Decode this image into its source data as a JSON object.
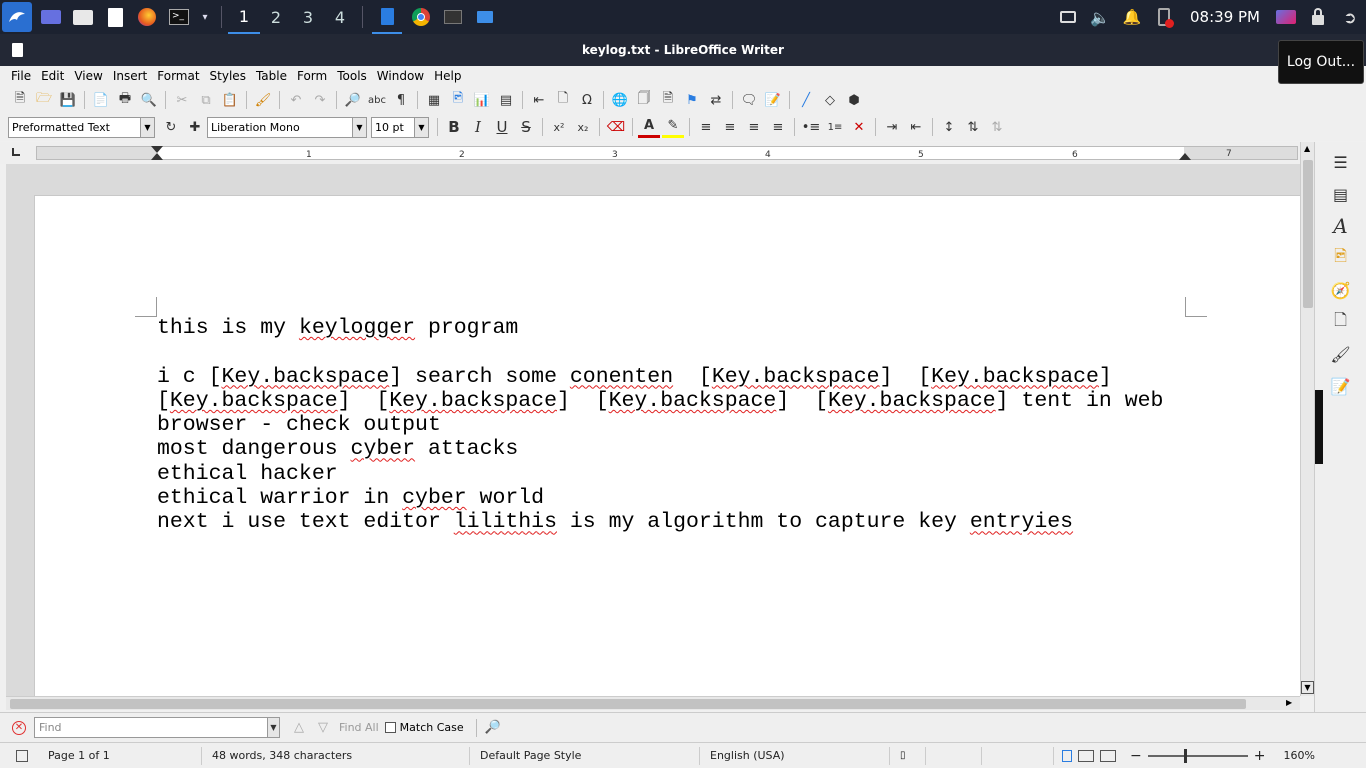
{
  "taskbar": {
    "workspaces": [
      "1",
      "2",
      "3",
      "4"
    ],
    "active_workspace": "1",
    "clock": "08:39 PM",
    "icons": [
      "kali-menu-icon",
      "desktop-icon",
      "files-icon",
      "text-editor-icon",
      "firefox-icon",
      "terminal-icon",
      "writer-icon",
      "chrome-icon",
      "terminal-window-icon",
      "folder-icon",
      "screen-icon",
      "volume-icon",
      "bell-icon",
      "power-manager-icon",
      "display-icon",
      "lock-icon",
      "logout-icon"
    ]
  },
  "window": {
    "title": "keylog.txt - LibreOffice Writer",
    "logout_tooltip": "Log Out..."
  },
  "menubar": {
    "items": [
      "File",
      "Edit",
      "View",
      "Insert",
      "Format",
      "Styles",
      "Table",
      "Form",
      "Tools",
      "Window",
      "Help"
    ]
  },
  "formatting": {
    "paragraph_style": "Preformatted Text",
    "font_name": "Liberation Mono",
    "font_size": "10 pt",
    "bold": "B",
    "italic": "I",
    "underline": "U",
    "strike": "S",
    "font_color": "#cc0000",
    "highlight_color": "#ffff00"
  },
  "ruler": {
    "numbers": [
      "1",
      "2",
      "3",
      "4",
      "5",
      "6",
      "7"
    ]
  },
  "document": {
    "lines": [
      [
        {
          "t": "this is my "
        },
        {
          "t": "keylogger",
          "sq": true
        },
        {
          "t": " program"
        }
      ],
      [
        {
          "t": ""
        }
      ],
      [
        {
          "t": "i c ["
        },
        {
          "t": "Key.backspace",
          "sq": true
        },
        {
          "t": "] search some "
        },
        {
          "t": "conenten",
          "sq": true
        },
        {
          "t": "  ["
        },
        {
          "t": "Key.backspace",
          "sq": true
        },
        {
          "t": "]  ["
        },
        {
          "t": "Key.backspace",
          "sq": true
        },
        {
          "t": "]"
        }
      ],
      [
        {
          "t": "["
        },
        {
          "t": "Key.backspace",
          "sq": true
        },
        {
          "t": "]  ["
        },
        {
          "t": "Key.backspace",
          "sq": true
        },
        {
          "t": "]  ["
        },
        {
          "t": "Key.backspace",
          "sq": true
        },
        {
          "t": "]  ["
        },
        {
          "t": "Key.backspace",
          "sq": true
        },
        {
          "t": "] tent in web"
        }
      ],
      [
        {
          "t": "browser - check output"
        }
      ],
      [
        {
          "t": "most dangerous "
        },
        {
          "t": "cyber",
          "sq": true
        },
        {
          "t": " attacks"
        }
      ],
      [
        {
          "t": "ethical hacker"
        }
      ],
      [
        {
          "t": "ethical warrior in "
        },
        {
          "t": "cyber",
          "sq": true
        },
        {
          "t": " world"
        }
      ],
      [
        {
          "t": "next i use text editor "
        },
        {
          "t": "lilithis",
          "sq": true
        },
        {
          "t": " is my algorithm to capture key "
        },
        {
          "t": "entryies",
          "sq": true
        }
      ]
    ]
  },
  "findbar": {
    "placeholder": "Find",
    "find_all": "Find All",
    "match_case": "Match Case"
  },
  "statusbar": {
    "page": "Page 1 of 1",
    "words": "48 words, 348 characters",
    "page_style": "Default Page Style",
    "language": "English (USA)",
    "zoom": "160%",
    "zoom_level_fraction": 0.36
  }
}
